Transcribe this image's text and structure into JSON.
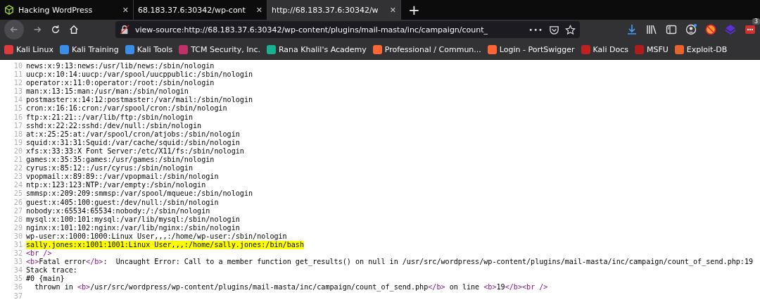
{
  "tabs": [
    {
      "title": "Hacking WordPress",
      "selected": false,
      "close": "✕"
    },
    {
      "title": "68.183.37.6:30342/wp-cont",
      "selected": false,
      "close": "✕"
    },
    {
      "title": "http://68.183.37.6:30342/w",
      "selected": true,
      "close": "✕"
    }
  ],
  "new_tab": "+",
  "address_bar": {
    "value": "view-source:http://68.183.37.6:30342/wp-content/plugins/mail-masta/inc/campaign/count_",
    "more": "•••"
  },
  "extension_badge": "3",
  "bookmarks": [
    {
      "label": "Kali Linux",
      "color": "#e03b3b"
    },
    {
      "label": "Kali Training",
      "color": "#3a8ee6"
    },
    {
      "label": "Kali Tools",
      "color": "#3a8ee6"
    },
    {
      "label": "TCM Security, Inc.",
      "color": "#c2306a"
    },
    {
      "label": "Rana Khalil's Academy",
      "color": "#19b28f"
    },
    {
      "label": "Professional / Commun...",
      "color": "#ff6633"
    },
    {
      "label": "Login - PortSwigger",
      "color": "#ff6633"
    },
    {
      "label": "Kali Docs",
      "color": "#c02020"
    },
    {
      "label": "MSFU",
      "color": "#b01c1c"
    },
    {
      "label": "Exploit-DB",
      "color": "#e8632b"
    }
  ],
  "source_lines": [
    {
      "number": "10",
      "highlighted": false,
      "segments": [
        {
          "kind": "text",
          "text": "news:x:9:13:news:/usr/lib/news:/sbin/nologin"
        }
      ]
    },
    {
      "number": "11",
      "highlighted": false,
      "segments": [
        {
          "kind": "text",
          "text": "uucp:x:10:14:uucp:/var/spool/uucppublic:/sbin/nologin"
        }
      ]
    },
    {
      "number": "12",
      "highlighted": false,
      "segments": [
        {
          "kind": "text",
          "text": "operator:x:11:0:operator:/root:/sbin/nologin"
        }
      ]
    },
    {
      "number": "13",
      "highlighted": false,
      "segments": [
        {
          "kind": "text",
          "text": "man:x:13:15:man:/usr/man:/sbin/nologin"
        }
      ]
    },
    {
      "number": "14",
      "highlighted": false,
      "segments": [
        {
          "kind": "text",
          "text": "postmaster:x:14:12:postmaster:/var/mail:/sbin/nologin"
        }
      ]
    },
    {
      "number": "15",
      "highlighted": false,
      "segments": [
        {
          "kind": "text",
          "text": "cron:x:16:16:cron:/var/spool/cron:/sbin/nologin"
        }
      ]
    },
    {
      "number": "16",
      "highlighted": false,
      "segments": [
        {
          "kind": "text",
          "text": "ftp:x:21:21::/var/lib/ftp:/sbin/nologin"
        }
      ]
    },
    {
      "number": "17",
      "highlighted": false,
      "segments": [
        {
          "kind": "text",
          "text": "sshd:x:22:22:sshd:/dev/null:/sbin/nologin"
        }
      ]
    },
    {
      "number": "18",
      "highlighted": false,
      "segments": [
        {
          "kind": "text",
          "text": "at:x:25:25:at:/var/spool/cron/atjobs:/sbin/nologin"
        }
      ]
    },
    {
      "number": "19",
      "highlighted": false,
      "segments": [
        {
          "kind": "text",
          "text": "squid:x:31:31:Squid:/var/cache/squid:/sbin/nologin"
        }
      ]
    },
    {
      "number": "20",
      "highlighted": false,
      "segments": [
        {
          "kind": "text",
          "text": "xfs:x:33:33:X Font Server:/etc/X11/fs:/sbin/nologin"
        }
      ]
    },
    {
      "number": "21",
      "highlighted": false,
      "segments": [
        {
          "kind": "text",
          "text": "games:x:35:35:games:/usr/games:/sbin/nologin"
        }
      ]
    },
    {
      "number": "22",
      "highlighted": false,
      "segments": [
        {
          "kind": "text",
          "text": "cyrus:x:85:12::/usr/cyrus:/sbin/nologin"
        }
      ]
    },
    {
      "number": "23",
      "highlighted": false,
      "segments": [
        {
          "kind": "text",
          "text": "vpopmail:x:89:89::/var/vpopmail:/sbin/nologin"
        }
      ]
    },
    {
      "number": "24",
      "highlighted": false,
      "segments": [
        {
          "kind": "text",
          "text": "ntp:x:123:123:NTP:/var/empty:/sbin/nologin"
        }
      ]
    },
    {
      "number": "25",
      "highlighted": false,
      "segments": [
        {
          "kind": "text",
          "text": "smmsp:x:209:209:smmsp:/var/spool/mqueue:/sbin/nologin"
        }
      ]
    },
    {
      "number": "26",
      "highlighted": false,
      "segments": [
        {
          "kind": "text",
          "text": "guest:x:405:100:guest:/dev/null:/sbin/nologin"
        }
      ]
    },
    {
      "number": "27",
      "highlighted": false,
      "segments": [
        {
          "kind": "text",
          "text": "nobody:x:65534:65534:nobody:/:/sbin/nologin"
        }
      ]
    },
    {
      "number": "28",
      "highlighted": false,
      "segments": [
        {
          "kind": "text",
          "text": "mysql:x:100:101:mysql:/var/lib/mysql:/sbin/nologin"
        }
      ]
    },
    {
      "number": "29",
      "highlighted": false,
      "segments": [
        {
          "kind": "text",
          "text": "nginx:x:101:102:nginx:/var/lib/nginx:/sbin/nologin"
        }
      ]
    },
    {
      "number": "30",
      "highlighted": false,
      "segments": [
        {
          "kind": "text",
          "text": "wp-user:x:1000:1000:Linux User,,,:/home/wp-user:/sbin/nologin"
        }
      ]
    },
    {
      "number": "31",
      "highlighted": true,
      "segments": [
        {
          "kind": "text",
          "text": "sally.jones:x:1001:1001:Linux User,,,:/home/sally.jones:/bin/bash"
        }
      ]
    },
    {
      "number": "32",
      "highlighted": false,
      "segments": [
        {
          "kind": "tag",
          "text": "<br />"
        }
      ]
    },
    {
      "number": "33",
      "highlighted": false,
      "segments": [
        {
          "kind": "tag",
          "text": "<b>"
        },
        {
          "kind": "text",
          "text": "Fatal error"
        },
        {
          "kind": "tag",
          "text": "</b>"
        },
        {
          "kind": "text",
          "text": ":  Uncaught Error: Call to a member function get_results() on null in /usr/src/wordpress/wp-content/plugins/mail-masta/inc/campaign/count_of_send.php:19"
        }
      ]
    },
    {
      "number": "34",
      "highlighted": false,
      "segments": [
        {
          "kind": "text",
          "text": "Stack trace:"
        }
      ]
    },
    {
      "number": "35",
      "highlighted": false,
      "segments": [
        {
          "kind": "text",
          "text": "#0 {main}"
        }
      ]
    },
    {
      "number": "36",
      "highlighted": false,
      "segments": [
        {
          "kind": "text",
          "text": "  thrown in "
        },
        {
          "kind": "tag",
          "text": "<b>"
        },
        {
          "kind": "text",
          "text": "/usr/src/wordpress/wp-content/plugins/mail-masta/inc/campaign/count_of_send.php"
        },
        {
          "kind": "tag",
          "text": "</b>"
        },
        {
          "kind": "text",
          "text": " on line "
        },
        {
          "kind": "tag",
          "text": "<b>"
        },
        {
          "kind": "text",
          "text": "19"
        },
        {
          "kind": "tag",
          "text": "</b>"
        },
        {
          "kind": "tag",
          "text": "<br />"
        }
      ]
    },
    {
      "number": "37"
    }
  ]
}
